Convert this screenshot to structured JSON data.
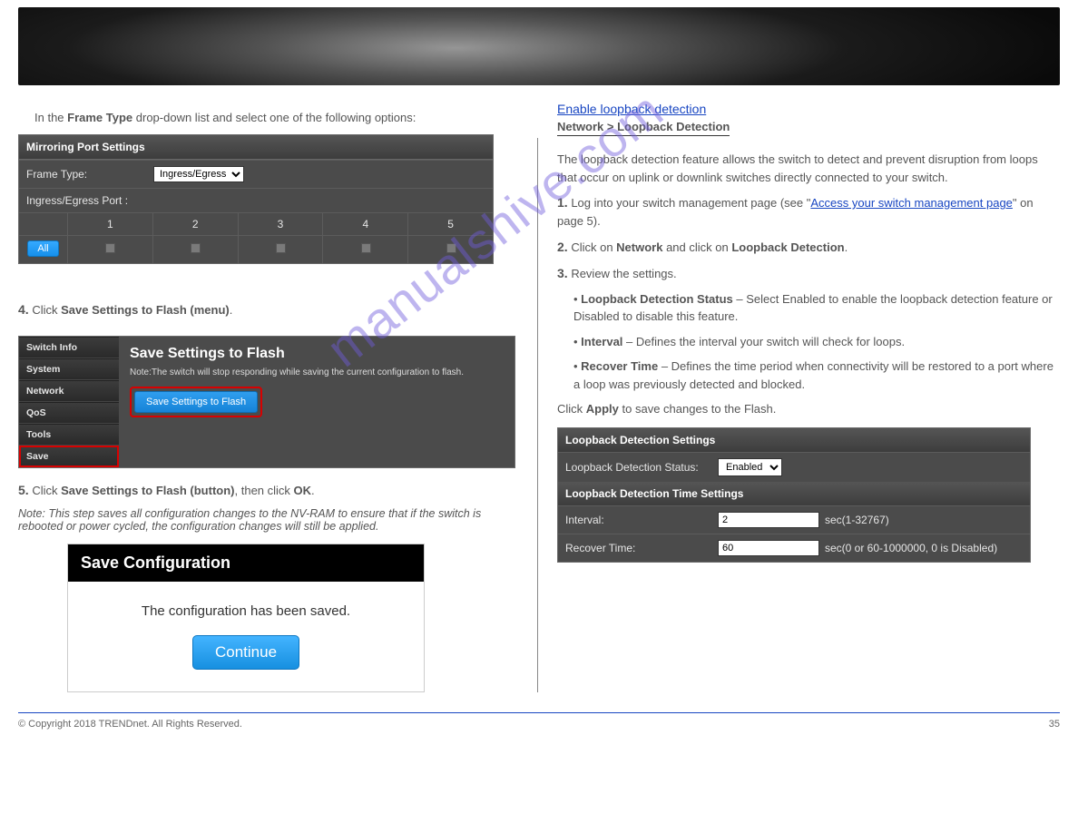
{
  "watermark": "manualshive.com",
  "left": {
    "mirroring": {
      "title": "Mirroring Port Settings",
      "frameTypeLabel": "Frame Type:",
      "frameTypeValue": "Ingress/Egress",
      "portHdr": "Ingress/Egress Port :",
      "cols": [
        "1",
        "2",
        "3",
        "4",
        "5"
      ],
      "allBtn": "All"
    },
    "step4_num": "4.",
    "step4_text": "Click Save Settings to Flash (menu).",
    "saveUI": {
      "nav": [
        "Switch Info",
        "System",
        "Network",
        "QoS",
        "Tools",
        "Save"
      ],
      "paneTitle": "Save Settings to Flash",
      "paneNote": "Note:The switch will stop responding while saving the current configuration to flash.",
      "paneBtn": "Save Settings to Flash"
    },
    "step5_num": "5.",
    "step5_text": "Click Save Settings to Flash (button), then click OK.",
    "noteSave": "Note: This step saves all configuration changes to the NV-RAM to ensure that if the switch is rebooted or power cycled, the configuration changes will still be applied.",
    "confirm": {
      "hdr": "Save Configuration",
      "msg": "The configuration has been saved.",
      "btn": "Continue"
    }
  },
  "right": {
    "ldHeading": "Enable loopback detection",
    "subnav": "Network > Loopback Detection",
    "intro": "The loopback detection feature allows the switch to detect and prevent disruption from loops that occur on uplink or downlink switches directly connected to your switch.",
    "s1_num": "1.",
    "s1_text_a": "Log into your switch management page (see \"",
    "s1_link": "Access your switch management page",
    "s1_text_b": "\" on page 5).",
    "s2_num": "2.",
    "s2_text": "Click on Network and click on Loopback Detection.",
    "s3_num": "3.",
    "s3_text": "Review the settings.",
    "bullet1_a": "Loopback Detection Status",
    "bullet1_b": " – Select Enabled to enable the loopback detection feature or Disabled to disable this feature.",
    "bullet2_a": "Interval",
    "bullet2_b": " – Defines the interval your switch will check for loops.",
    "bullet3_a": "Recover Time",
    "bullet3_b": " – Defines the time period when connectivity will be restored to a port where a loop was previously detected and blocked.",
    "applyText": "Click Apply to save changes to the Flash.",
    "ldPanel": {
      "title1": "Loopback Detection Settings",
      "statusLbl": "Loopback Detection Status:",
      "statusVal": "Enabled",
      "title2": "Loopback Detection Time Settings",
      "intervalLbl": "Interval:",
      "intervalVal": "2",
      "intervalUnit": "sec(1-32767)",
      "recoverLbl": "Recover Time:",
      "recoverVal": "60",
      "recoverUnit": "sec(0 or 60-1000000, 0 is Disabled)"
    }
  },
  "footer": {
    "copyright": "© Copyright 2018 TRENDnet. All Rights Reserved.",
    "page": "35"
  }
}
